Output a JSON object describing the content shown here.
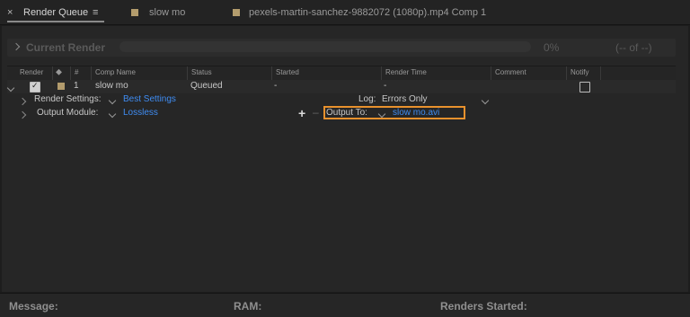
{
  "tabs": [
    {
      "label": "Render Queue"
    },
    {
      "label": "slow mo"
    },
    {
      "label": "pexels-martin-sanchez-9882072 (1080p).mp4 Comp 1"
    }
  ],
  "progress": {
    "label": "Current Render",
    "percent": "0%",
    "time": "(-- of --)"
  },
  "columns": [
    "Render",
    "#",
    "Comp Name",
    "Status",
    "Started",
    "Render Time",
    "Comment",
    "Notify"
  ],
  "queue_item": {
    "index": "1",
    "comp_name": "slow mo",
    "status": "Queued",
    "started": "-",
    "render_time": "-",
    "render_checked": true,
    "notify_checked": false
  },
  "render_settings": {
    "label": "Render Settings:",
    "value": "Best Settings",
    "log_label": "Log:",
    "log_value": "Errors Only"
  },
  "output_module": {
    "label": "Output Module:",
    "value": "Lossless",
    "output_to_label": "Output To:",
    "output_to_value": "slow mo.avi"
  },
  "footer": {
    "message": "Message:",
    "ram": "RAM:",
    "renders_started": "Renders Started:"
  },
  "colors": {
    "accent_link": "#3f8cf2",
    "highlight": "#e8912d",
    "label_swatch": "#b39c6d"
  }
}
